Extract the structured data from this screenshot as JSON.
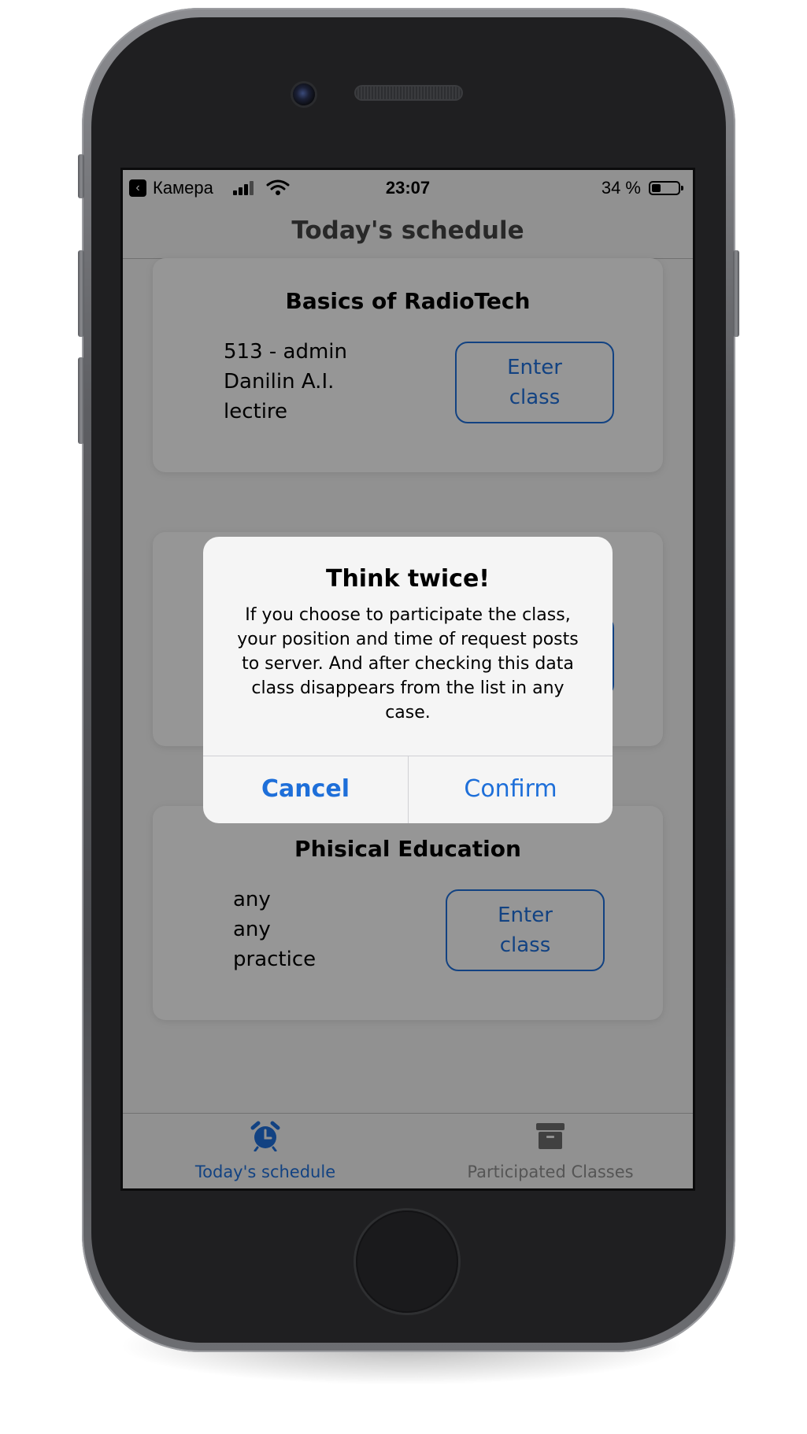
{
  "status_bar": {
    "back_icon": "back-arrow-icon",
    "back_glyph": "‹",
    "carrier": "Камера",
    "time": "23:07",
    "battery_percent_text": "34 %",
    "battery_level": 0.34
  },
  "nav": {
    "title": "Today's schedule"
  },
  "cards": [
    {
      "title": "Basics of RadioTech",
      "lines": [
        "513 - admin",
        "Danilin A.I.",
        "lectire"
      ],
      "button_lines": [
        "Enter",
        "class"
      ]
    },
    {
      "title": "",
      "lines": [],
      "button_lines": []
    },
    {
      "title": "Phisical Education",
      "lines": [
        "any",
        "any",
        "practice"
      ],
      "button_lines": [
        "Enter",
        "class"
      ]
    }
  ],
  "tabs": [
    {
      "label": "Today's schedule",
      "icon": "alarm-clock-icon",
      "active": true
    },
    {
      "label": "Participated Classes",
      "icon": "archive-box-icon",
      "active": false
    }
  ],
  "alert": {
    "title": "Think twice!",
    "message_lines": [
      "If you choose to participate the class,",
      "your position and time of request posts",
      "to server. And after checking this data",
      "class disappears from the list in any",
      "case."
    ],
    "cancel_label": "Cancel",
    "confirm_label": "Confirm"
  },
  "colors": {
    "accent": "#1e6fd9",
    "tab_inactive": "#8e8e8e",
    "overlay": "rgba(0,0,0,0.40)"
  }
}
